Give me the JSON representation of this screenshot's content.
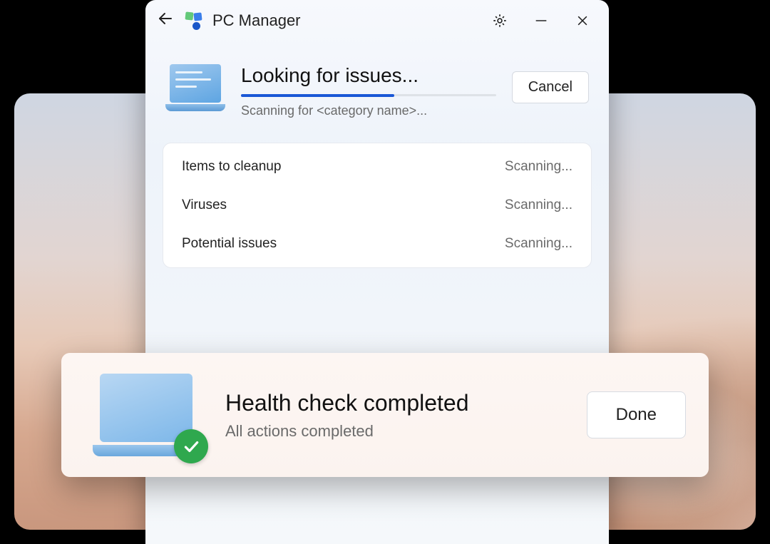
{
  "app": {
    "title": "PC Manager"
  },
  "scan": {
    "title": "Looking for issues...",
    "subtitle": "Scanning for <category name>...",
    "cancel_label": "Cancel",
    "progress_percent": 60
  },
  "items": [
    {
      "label": "Items to cleanup",
      "status": "Scanning..."
    },
    {
      "label": "Viruses",
      "status": "Scanning..."
    },
    {
      "label": "Potential issues",
      "status": "Scanning..."
    }
  ],
  "toast": {
    "title": "Health check completed",
    "subtitle": "All actions completed",
    "done_label": "Done"
  }
}
